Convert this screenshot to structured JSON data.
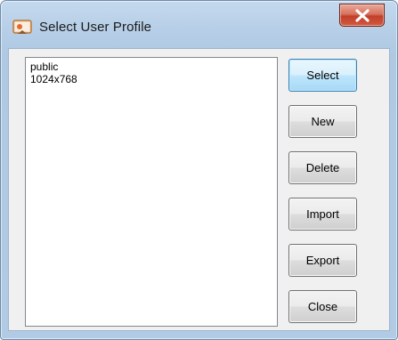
{
  "window": {
    "title": "Select User Profile",
    "icon": "app-window-icon",
    "close_icon": "close-icon"
  },
  "profiles": {
    "items": [
      "public",
      "1024x768"
    ]
  },
  "buttons": {
    "select": "Select",
    "new": "New",
    "delete": "Delete",
    "import": "Import",
    "export": "Export",
    "close": "Close"
  },
  "colors": {
    "default_button_border": "#3c7fb1",
    "close_button": "#c2402a",
    "frame": "#b7cfe7"
  }
}
